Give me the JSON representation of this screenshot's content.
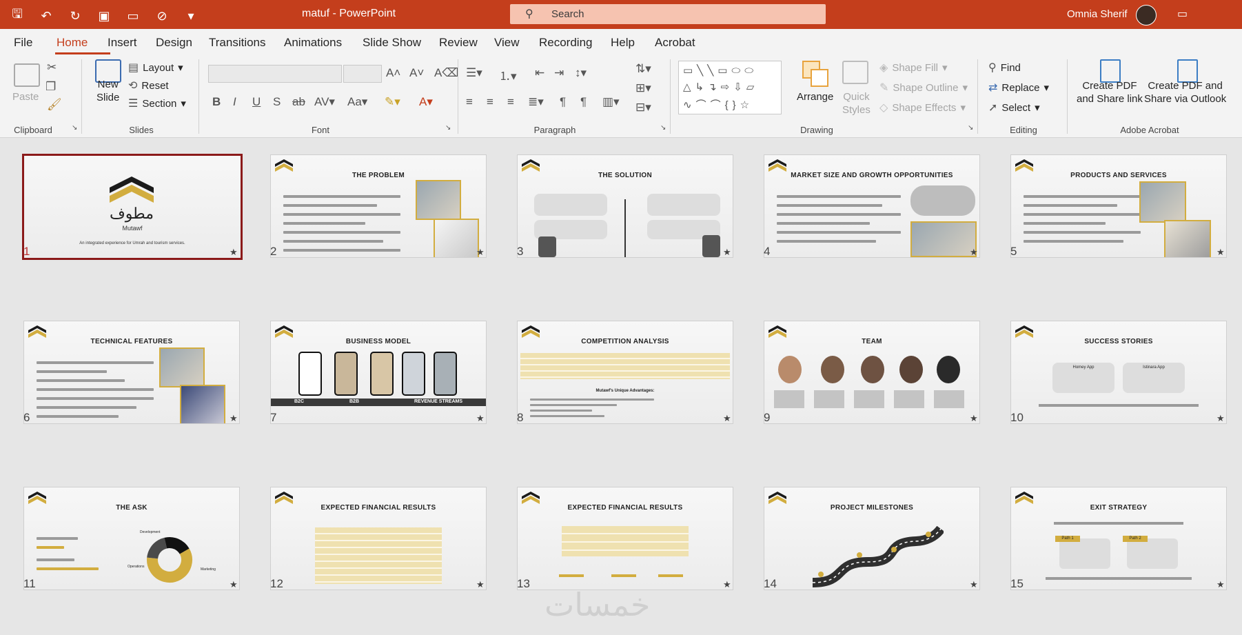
{
  "app": {
    "title": "matuf  -  PowerPoint",
    "search_placeholder": "Search",
    "user_name": "Omnia Sherif",
    "accent": "#c43e1c"
  },
  "menu": [
    "File",
    "Home",
    "Insert",
    "Design",
    "Transitions",
    "Animations",
    "Slide Show",
    "Review",
    "View",
    "Recording",
    "Help",
    "Acrobat"
  ],
  "ribbon": {
    "clipboard": {
      "paste": "Paste",
      "label": "Clipboard"
    },
    "slides": {
      "new_slide_1": "New",
      "new_slide_2": "Slide",
      "layout": "Layout",
      "reset": "Reset",
      "section": "Section",
      "label": "Slides"
    },
    "font": {
      "label": "Font"
    },
    "paragraph": {
      "label": "Paragraph"
    },
    "drawing": {
      "arrange": "Arrange",
      "quick_styles_1": "Quick",
      "quick_styles_2": "Styles",
      "shape_fill": "Shape Fill",
      "shape_outline": "Shape Outline",
      "shape_effects": "Shape Effects",
      "label": "Drawing"
    },
    "editing": {
      "find": "Find",
      "replace": "Replace",
      "select": "Select",
      "label": "Editing"
    },
    "acrobat": {
      "pdf_link_1": "Create PDF",
      "pdf_link_2": "and Share link",
      "pdf_outlook_1": "Create PDF and",
      "pdf_outlook_2": "Share via Outlook",
      "label": "Adobe Acrobat"
    }
  },
  "slides": [
    {
      "num": "1",
      "title": "",
      "caption": "An integrated experience for Umrah and tourism services.",
      "brand": "Mutawf"
    },
    {
      "num": "2",
      "title": "THE PROBLEM"
    },
    {
      "num": "3",
      "title": "THE SOLUTION"
    },
    {
      "num": "4",
      "title": "MARKET SIZE AND GROWTH OPPORTUNITIES"
    },
    {
      "num": "5",
      "title": "PRODUCTS AND SERVICES"
    },
    {
      "num": "6",
      "title": "TECHNICAL FEATURES"
    },
    {
      "num": "7",
      "title": "BUSINESS MODEL",
      "cols": [
        "B2C",
        "B2B",
        "REVENUE STREAMS"
      ]
    },
    {
      "num": "8",
      "title": "COMPETITION ANALYSIS",
      "subtitle": "Mutawf's Unique Advantages:"
    },
    {
      "num": "9",
      "title": "TEAM"
    },
    {
      "num": "10",
      "title": "SUCCESS STORIES",
      "cards": [
        "Homey App",
        "Istinara App"
      ]
    },
    {
      "num": "11",
      "title": "THE ASK",
      "labels": [
        "Development",
        "Operations",
        "Marketing"
      ]
    },
    {
      "num": "12",
      "title": "EXPECTED FINANCIAL RESULTS"
    },
    {
      "num": "13",
      "title": "EXPECTED FINANCIAL RESULTS"
    },
    {
      "num": "14",
      "title": "PROJECT MILESTONES"
    },
    {
      "num": "15",
      "title": "EXIT STRATEGY",
      "paths": [
        "Path 1",
        "Path 2"
      ]
    }
  ],
  "watermark": "خمسات"
}
